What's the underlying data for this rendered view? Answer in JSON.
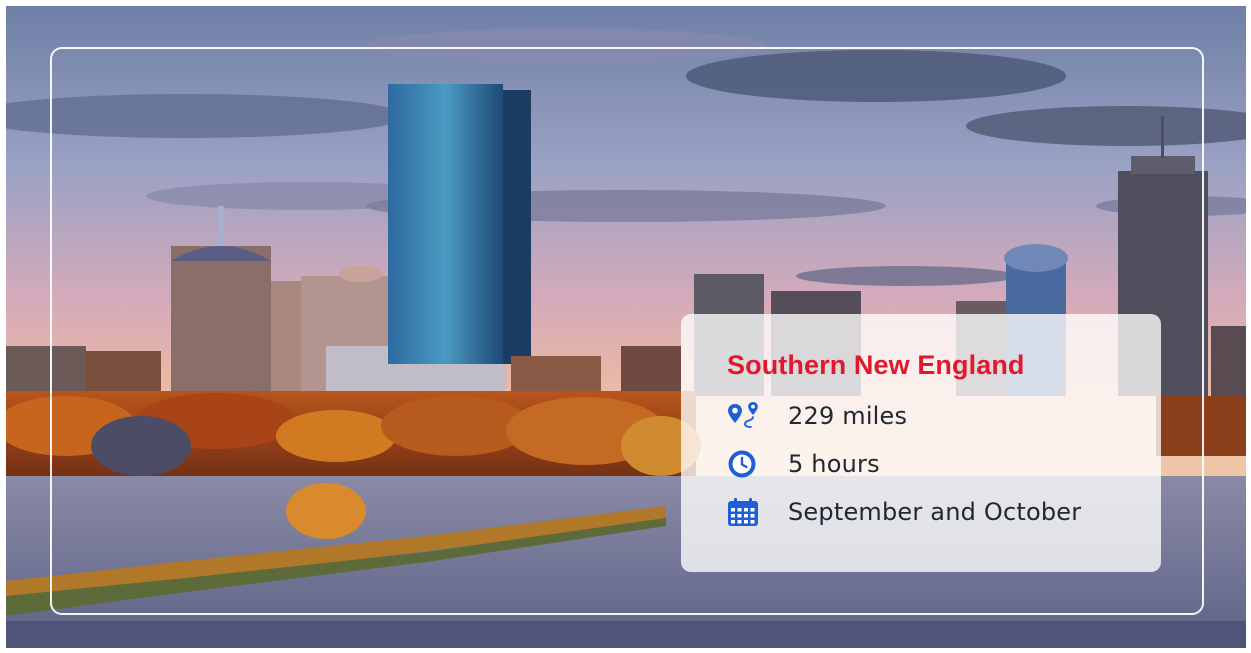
{
  "card": {
    "title": "Southern New England",
    "items": [
      {
        "icon": "route-pin-icon",
        "text": "229 miles"
      },
      {
        "icon": "clock-icon",
        "text": "5 hours"
      },
      {
        "icon": "calendar-icon",
        "text": "September and October"
      }
    ]
  },
  "colors": {
    "title": "#e1192c",
    "icon": "#1f5fd6",
    "text": "#222831"
  }
}
